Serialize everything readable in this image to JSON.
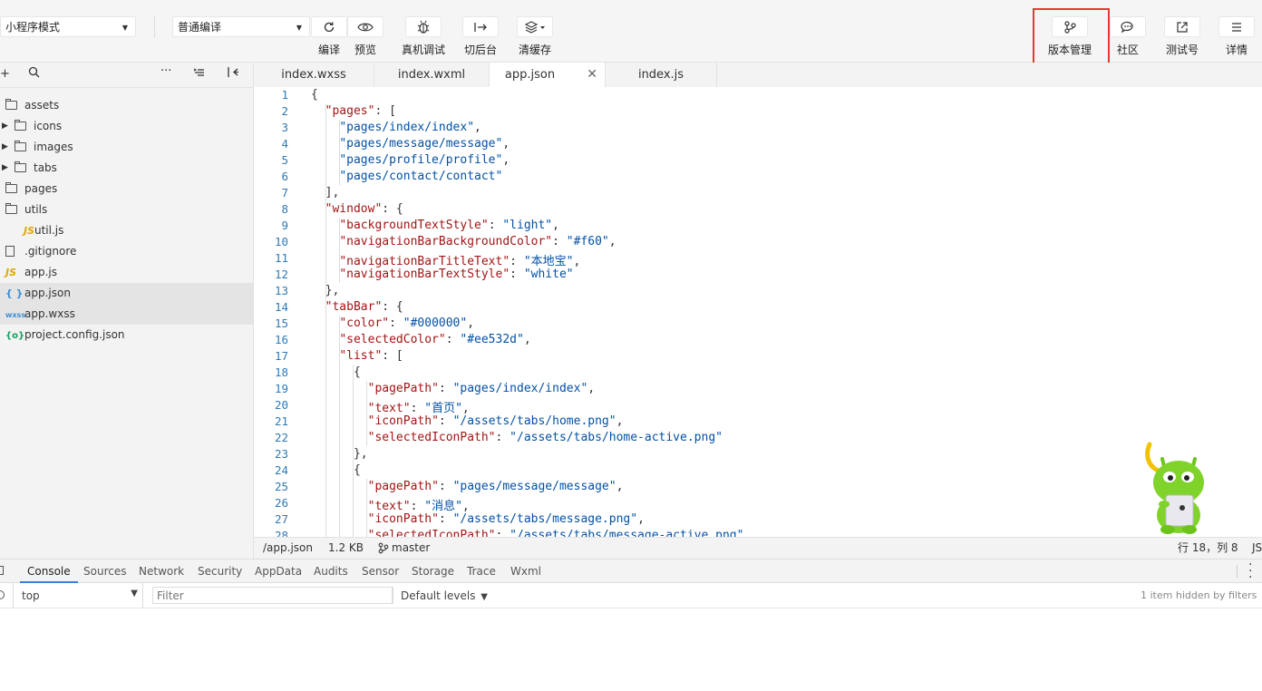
{
  "toolbar": {
    "mode_select": "小程序模式",
    "compile_select": "普通编译",
    "buttons": {
      "compile": "编译",
      "preview": "预览",
      "remote_debug": "真机调试",
      "background": "切后台",
      "clear_cache": "清缓存",
      "version": "版本管理",
      "community": "社区",
      "test_account": "测试号",
      "details": "详情"
    }
  },
  "sidebar": {
    "tree": [
      {
        "name": "assets",
        "type": "folder-open",
        "depth": 0
      },
      {
        "name": "icons",
        "type": "folder",
        "depth": 1
      },
      {
        "name": "images",
        "type": "folder",
        "depth": 1
      },
      {
        "name": "tabs",
        "type": "folder",
        "depth": 1
      },
      {
        "name": "pages",
        "type": "folder-open",
        "depth": 0
      },
      {
        "name": "utils",
        "type": "folder-open",
        "depth": 0
      },
      {
        "name": "util.js",
        "type": "js",
        "depth": 1
      },
      {
        "name": ".gitignore",
        "type": "file",
        "depth": 0
      },
      {
        "name": "app.js",
        "type": "js",
        "depth": 0
      },
      {
        "name": "app.json",
        "type": "json",
        "depth": 0
      },
      {
        "name": "app.wxss",
        "type": "wxss",
        "depth": 0
      },
      {
        "name": "project.config.json",
        "type": "config",
        "depth": 0
      }
    ],
    "icon_labels": {
      "js": "JS",
      "json": "{ }",
      "wxss": "wxss",
      "config": "{o}"
    }
  },
  "tabs": [
    "index.wxss",
    "index.wxml",
    "app.json",
    "index.js"
  ],
  "editor": {
    "lines": [
      [
        [
          "p",
          "{"
        ]
      ],
      [
        [
          "p",
          "  "
        ],
        [
          "k",
          "\"pages\""
        ],
        [
          "p",
          ": ["
        ]
      ],
      [
        [
          "p",
          "    "
        ],
        [
          "s",
          "\"pages/index/index\""
        ],
        [
          "p",
          ","
        ]
      ],
      [
        [
          "p",
          "    "
        ],
        [
          "s",
          "\"pages/message/message\""
        ],
        [
          "p",
          ","
        ]
      ],
      [
        [
          "p",
          "    "
        ],
        [
          "s",
          "\"pages/profile/profile\""
        ],
        [
          "p",
          ","
        ]
      ],
      [
        [
          "p",
          "    "
        ],
        [
          "s",
          "\"pages/contact/contact\""
        ]
      ],
      [
        [
          "p",
          "  ],"
        ]
      ],
      [
        [
          "p",
          "  "
        ],
        [
          "k",
          "\"window\""
        ],
        [
          "p",
          ": {"
        ]
      ],
      [
        [
          "p",
          "    "
        ],
        [
          "k",
          "\"backgroundTextStyle\""
        ],
        [
          "p",
          ": "
        ],
        [
          "s",
          "\"light\""
        ],
        [
          "p",
          ","
        ]
      ],
      [
        [
          "p",
          "    "
        ],
        [
          "k",
          "\"navigationBarBackgroundColor\""
        ],
        [
          "p",
          ": "
        ],
        [
          "s",
          "\"#f60\""
        ],
        [
          "p",
          ","
        ]
      ],
      [
        [
          "p",
          "    "
        ],
        [
          "k",
          "\"navigationBarTitleText\""
        ],
        [
          "p",
          ": "
        ],
        [
          "s",
          "\"本地宝\""
        ],
        [
          "p",
          ","
        ]
      ],
      [
        [
          "p",
          "    "
        ],
        [
          "k",
          "\"navigationBarTextStyle\""
        ],
        [
          "p",
          ": "
        ],
        [
          "s",
          "\"white\""
        ]
      ],
      [
        [
          "p",
          "  },"
        ]
      ],
      [
        [
          "p",
          "  "
        ],
        [
          "k",
          "\"tabBar\""
        ],
        [
          "p",
          ": {"
        ]
      ],
      [
        [
          "p",
          "    "
        ],
        [
          "k",
          "\"color\""
        ],
        [
          "p",
          ": "
        ],
        [
          "s",
          "\"#000000\""
        ],
        [
          "p",
          ","
        ]
      ],
      [
        [
          "p",
          "    "
        ],
        [
          "k",
          "\"selectedColor\""
        ],
        [
          "p",
          ": "
        ],
        [
          "s",
          "\"#ee532d\""
        ],
        [
          "p",
          ","
        ]
      ],
      [
        [
          "p",
          "    "
        ],
        [
          "k",
          "\"list\""
        ],
        [
          "p",
          ": ["
        ]
      ],
      [
        [
          "p",
          "      {"
        ]
      ],
      [
        [
          "p",
          "        "
        ],
        [
          "k",
          "\"pagePath\""
        ],
        [
          "p",
          ": "
        ],
        [
          "s",
          "\"pages/index/index\""
        ],
        [
          "p",
          ","
        ]
      ],
      [
        [
          "p",
          "        "
        ],
        [
          "k",
          "\"text\""
        ],
        [
          "p",
          ": "
        ],
        [
          "s",
          "\"首页\""
        ],
        [
          "p",
          ","
        ]
      ],
      [
        [
          "p",
          "        "
        ],
        [
          "k",
          "\"iconPath\""
        ],
        [
          "p",
          ": "
        ],
        [
          "s",
          "\"/assets/tabs/home.png\""
        ],
        [
          "p",
          ","
        ]
      ],
      [
        [
          "p",
          "        "
        ],
        [
          "k",
          "\"selectedIconPath\""
        ],
        [
          "p",
          ": "
        ],
        [
          "s",
          "\"/assets/tabs/home-active.png\""
        ]
      ],
      [
        [
          "p",
          "      },"
        ]
      ],
      [
        [
          "p",
          "      {"
        ]
      ],
      [
        [
          "p",
          "        "
        ],
        [
          "k",
          "\"pagePath\""
        ],
        [
          "p",
          ": "
        ],
        [
          "s",
          "\"pages/message/message\""
        ],
        [
          "p",
          ","
        ]
      ],
      [
        [
          "p",
          "        "
        ],
        [
          "k",
          "\"text\""
        ],
        [
          "p",
          ": "
        ],
        [
          "s",
          "\"消息\""
        ],
        [
          "p",
          ","
        ]
      ],
      [
        [
          "p",
          "        "
        ],
        [
          "k",
          "\"iconPath\""
        ],
        [
          "p",
          ": "
        ],
        [
          "s",
          "\"/assets/tabs/message.png\""
        ],
        [
          "p",
          ","
        ]
      ],
      [
        [
          "p",
          "        "
        ],
        [
          "k",
          "\"selectedIconPath\""
        ],
        [
          "p",
          ": "
        ],
        [
          "s",
          "\"/assets/tabs/message-active.png\""
        ]
      ]
    ]
  },
  "statusbar": {
    "path": "/app.json",
    "size": "1.2 KB",
    "branch": "master",
    "cursor": "行 18，列 8",
    "lang": "JS"
  },
  "devtools": {
    "tabs": [
      "Console",
      "Sources",
      "Network",
      "Security",
      "AppData",
      "Audits",
      "Sensor",
      "Storage",
      "Trace",
      "Wxml"
    ],
    "context": "top",
    "filter_placeholder": "Filter",
    "levels": "Default levels",
    "hidden_info": "1 item hidden by filters"
  },
  "colors": {
    "highlight": "#e53935",
    "active_tab_underline": "#3b7ddd",
    "keyword": "#a31515",
    "string": "#0451a5",
    "line_number": "#2e7ab8"
  }
}
